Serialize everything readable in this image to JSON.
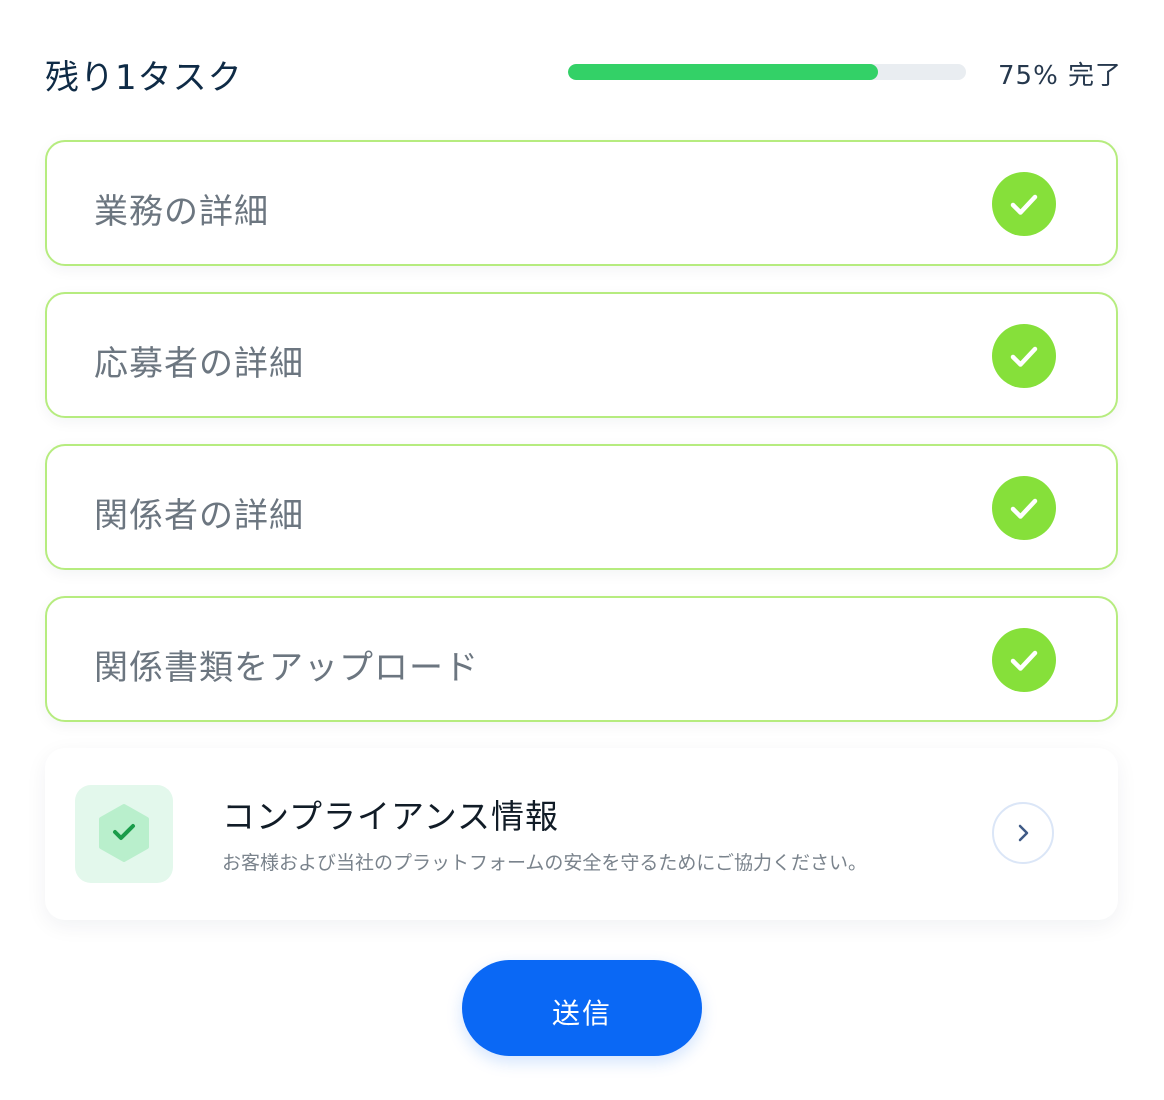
{
  "header": {
    "title": "残り1タスク",
    "progress_label": "75% 完了",
    "progress_fraction": 0.78,
    "progress_color": "#33d167"
  },
  "tasks": [
    {
      "label": "業務の詳細",
      "status": "complete",
      "icon": "check-icon"
    },
    {
      "label": "応募者の詳細",
      "status": "complete",
      "icon": "check-icon"
    },
    {
      "label": "関係者の詳細",
      "status": "complete",
      "icon": "check-icon"
    },
    {
      "label": "関係書類をアップロード",
      "status": "complete",
      "icon": "check-icon"
    }
  ],
  "compliance": {
    "title": "コンプライアンス情報",
    "description": "お客様および当社のプラットフォームの安全を守るためにご協力ください。",
    "icon": "shield-check-icon",
    "action_icon": "chevron-right-icon"
  },
  "submit": {
    "label": "送信",
    "color": "#0a68f5"
  },
  "colors": {
    "complete_border": "#b6ec7f",
    "complete_badge": "#86e03a",
    "shield_tile": "#e3f8ec",
    "shield": "#b9efcc"
  }
}
